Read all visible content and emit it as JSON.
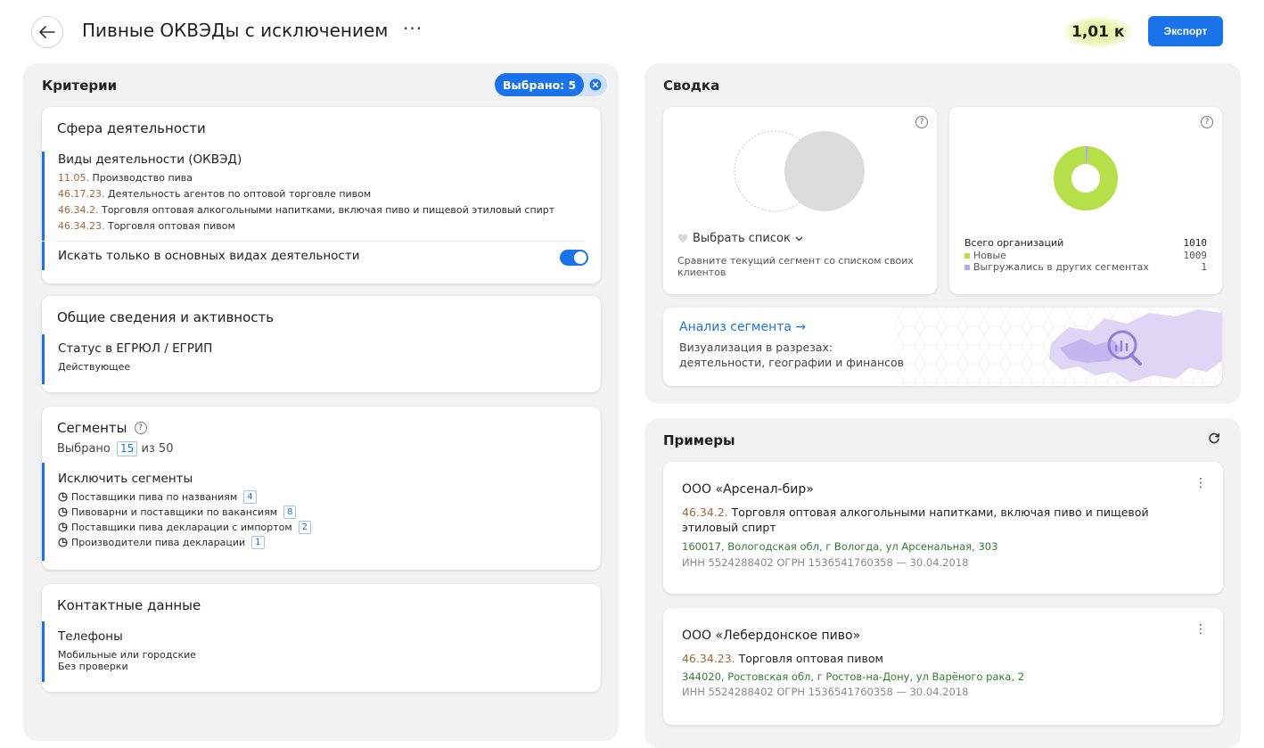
{
  "header": {
    "title": "Пивные ОКВЭДы с исключением",
    "more": "···",
    "count": "1,01 к",
    "export_label": "Экспорт"
  },
  "criteria": {
    "heading": "Критерии",
    "selected_label": "Выбрано: 5",
    "activity": {
      "title": "Сфера деятельности",
      "okved_title": "Виды деятельности (ОКВЭД)",
      "items": [
        {
          "code": "11.05.",
          "text": " Производство пива"
        },
        {
          "code": "46.17.23.",
          "text": " Деятельность агентов по оптовой торговле пивом"
        },
        {
          "code": "46.34.2.",
          "text": " Торговля оптовая алкогольными напитками, включая пиво и пищевой этиловый спирт"
        },
        {
          "code": "46.34.23.",
          "text": " Торговля оптовая пивом"
        }
      ],
      "main_only_label": "Искать только в основных видах деятельности",
      "main_only_enabled": true
    },
    "general": {
      "title": "Общие сведения и активность",
      "status_title": "Статус в ЕГРЮЛ / ЕГРИП",
      "status_value": "Действующее"
    },
    "segments": {
      "title": "Сегменты",
      "help": "?",
      "selected_prefix": "Выбрано",
      "selected_count": "15",
      "selected_suffix": "из 50",
      "exclude_title": "Исключить сегменты",
      "items": [
        {
          "label": "Поставщики пива по названиям",
          "count": "4"
        },
        {
          "label": "Пивоварни и поставщики по вакансиям",
          "count": "8"
        },
        {
          "label": "Поставщики пива декларации с импортом",
          "count": "2"
        },
        {
          "label": "Производители пива декларации",
          "count": "1"
        }
      ]
    },
    "contacts": {
      "title": "Контактные данные",
      "phones_title": "Телефоны",
      "phones_lines": [
        "Мобильные или городские",
        "Без проверки"
      ]
    }
  },
  "summary": {
    "heading": "Сводка",
    "help": "?",
    "compare": {
      "select_label": "Выбрать список",
      "description": "Сравните текущий сегмент со списком своих клиентов"
    },
    "stats": {
      "total_label": "Всего организаций",
      "total_value": "1010",
      "new_label": "Новые",
      "new_value": "1009",
      "exported_label": "Выгружались в других сегментах",
      "exported_value": "1",
      "new_fraction": 0.999,
      "colors": {
        "new": "#b5e04a",
        "exported": "#b9a6ef"
      }
    },
    "analysis": {
      "title": "Анализ сегмента →",
      "line1": "Визуализация в разрезах:",
      "line2": "деятельности, географии и финансов"
    }
  },
  "examples": {
    "heading": "Примеры",
    "items": [
      {
        "name": "ООО «Арсенал-бир»",
        "code": "46.34.2.",
        "text": " Торговля оптовая алкогольными напитками, включая пиво и пищевой этиловый спирт",
        "address": "160017, Вологодская обл, г Вологда, ул Арсенальная, 303",
        "ids": "ИНН 5524288402    ОГРН 1536541760358 — 30.04.2018"
      },
      {
        "name": "ООО «Лебердонское пиво»",
        "code": "46.34.23.",
        "text": " Торговля оптовая пивом",
        "address": "344020, Ростовская обл, г Ростов-на-Дону, ул Варёного рака, 2",
        "ids": "ИНН 5524288402    ОГРН 1536541760358 — 30.04.2018"
      }
    ]
  },
  "colors": {
    "accent": "#1a73e8",
    "okved_code": "#a0693a",
    "address": "#2f7d33"
  }
}
